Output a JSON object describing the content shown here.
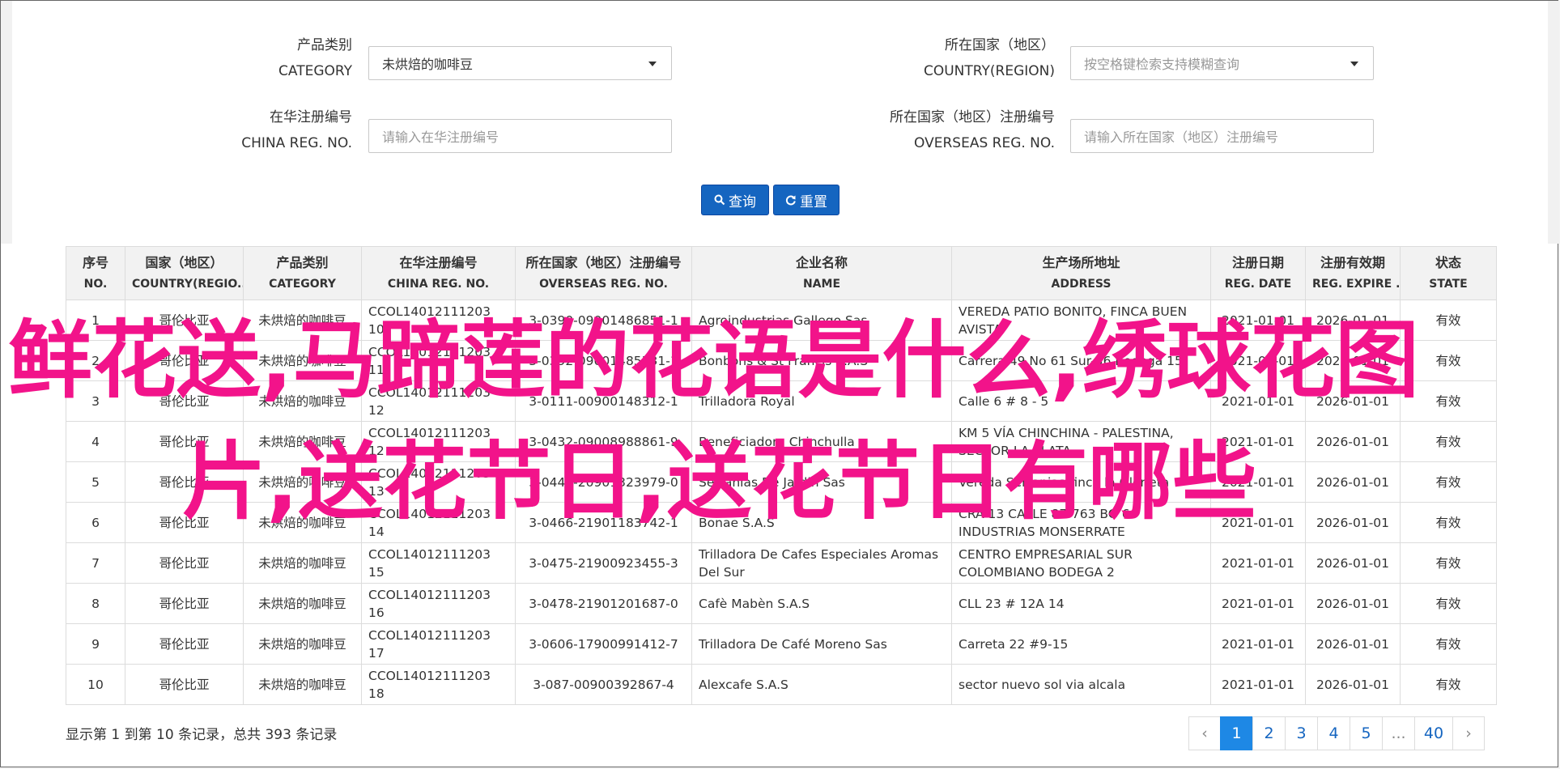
{
  "filters": {
    "category": {
      "label_cn": "产品类别",
      "label_en": "CATEGORY",
      "value": "未烘焙的咖啡豆"
    },
    "country": {
      "label_cn": "所在国家（地区）",
      "label_en": "COUNTRY(REGION)",
      "placeholder": "按空格键检索支持模糊查询"
    },
    "china_reg": {
      "label_cn": "在华注册编号",
      "label_en": "CHINA REG. NO.",
      "placeholder": "请输入在华注册编号"
    },
    "overseas_reg": {
      "label_cn": "所在国家（地区）注册编号",
      "label_en": "OVERSEAS REG. NO.",
      "placeholder": "请输入所在国家（地区）注册编号"
    }
  },
  "buttons": {
    "query": "查询",
    "reset": "重置"
  },
  "table": {
    "headers": [
      {
        "cn": "序号",
        "en": "NO."
      },
      {
        "cn": "国家（地区）",
        "en": "COUNTRY(REGIO..."
      },
      {
        "cn": "产品类别",
        "en": "CATEGORY"
      },
      {
        "cn": "在华注册编号",
        "en": "CHINA REG. NO."
      },
      {
        "cn": "所在国家（地区）注册编号",
        "en": "OVERSEAS REG. NO."
      },
      {
        "cn": "企业名称",
        "en": "NAME"
      },
      {
        "cn": "生产场所地址",
        "en": "ADDRESS"
      },
      {
        "cn": "注册日期",
        "en": "REG. DATE"
      },
      {
        "cn": "注册有效期",
        "en": "REG. EXPIRE ..."
      },
      {
        "cn": "状态",
        "en": "STATE"
      }
    ],
    "rows": [
      [
        "1",
        "哥伦比亚",
        "未烘焙的咖啡豆",
        "CCOL14012111203 10",
        "3-0390-09001486851-1",
        "Agroindustrias Gallego Sas",
        "VEREDA PATIO BONITO, FINCA BUEN AVISTA",
        "2021-01-01",
        "2026-01-01",
        "有效"
      ],
      [
        "2",
        "哥伦比亚",
        "未烘焙的咖啡豆",
        "CCOL14012111203 11",
        "3-0392-09001485531-1",
        "Bonbons & St Francis S.A.S",
        "Carrera 49 No 61 Sur-56 Bodega 15",
        "2021-01-01",
        "2026-01-01",
        "有效"
      ],
      [
        "3",
        "哥伦比亚",
        "未烘焙的咖啡豆",
        "CCOL14012111203 12",
        "3-0111-00900148312-1",
        "Trilladora Royal",
        "Calle 6 # 8 - 5",
        "2021-01-01",
        "2026-01-01",
        "有效"
      ],
      [
        "4",
        "哥伦比亚",
        "未烘焙的咖啡豆",
        "CCOL14012111203 12",
        "3-0432-09008988861-9",
        "Beneficiadora Chinchulla",
        "KM 5 VÍA CHINCHINA - PALESTINA, SECTOR LA PLATA",
        "2021-01-01",
        "2026-01-01",
        "有效"
      ],
      [
        "5",
        "哥伦比亚",
        "未烘焙的咖啡豆",
        "CCOL14012111203 13",
        "3-0440-20901323979-0",
        "Serranias De Jardin Sas",
        "Vereda Serranias-finca la Glorieta",
        "2021-01-01",
        "2026-01-01",
        "有效"
      ],
      [
        "6",
        "哥伦比亚",
        "未烘焙的咖啡豆",
        "CCOL14012111203 14",
        "3-0466-21901183742-1",
        "Bonae S.A.S",
        "CRA 13 CALLE 87-763 BG 6 INDUSTRIAS MONSERRATE",
        "2021-01-01",
        "2026-01-01",
        "有效"
      ],
      [
        "7",
        "哥伦比亚",
        "未烘焙的咖啡豆",
        "CCOL14012111203 15",
        "3-0475-21900923455-3",
        "Trilladora De Cafes Especiales Aromas Del Sur",
        "CENTRO EMPRESARIAL SUR COLOMBIANO BODEGA 2",
        "2021-01-01",
        "2026-01-01",
        "有效"
      ],
      [
        "8",
        "哥伦比亚",
        "未烘焙的咖啡豆",
        "CCOL14012111203 16",
        "3-0478-21901201687-0",
        "Cafè Mabèn S.A.S",
        "CLL 23 # 12A 14",
        "2021-01-01",
        "2026-01-01",
        "有效"
      ],
      [
        "9",
        "哥伦比亚",
        "未烘焙的咖啡豆",
        "CCOL14012111203 17",
        "3-0606-17900991412-7",
        "Trilladora De Café Moreno Sas",
        "Carreta 22 #9-15",
        "2021-01-01",
        "2026-01-01",
        "有效"
      ],
      [
        "10",
        "哥伦比亚",
        "未烘焙的咖啡豆",
        "CCOL14012111203 18",
        "3-087-00900392867-4",
        "Alexcafe S.A.S",
        "sector nuevo sol via alcala",
        "2021-01-01",
        "2026-01-01",
        "有效"
      ]
    ]
  },
  "overlay": {
    "line1": "鲜花送,马蹄莲的花语是什么,绣球花图",
    "line2": "片,送花节日,送花节日有哪些",
    "color": "#f2138a"
  },
  "footer": {
    "info": "显示第 1 到第 10 条记录，总共 393 条记录"
  },
  "pagination": {
    "prev": "‹",
    "next": "›",
    "pages": [
      "1",
      "2",
      "3",
      "4",
      "5",
      "...",
      "40"
    ],
    "active": "1"
  },
  "colors": {
    "primary": "#1565c0",
    "active_page": "#1e88e5"
  }
}
